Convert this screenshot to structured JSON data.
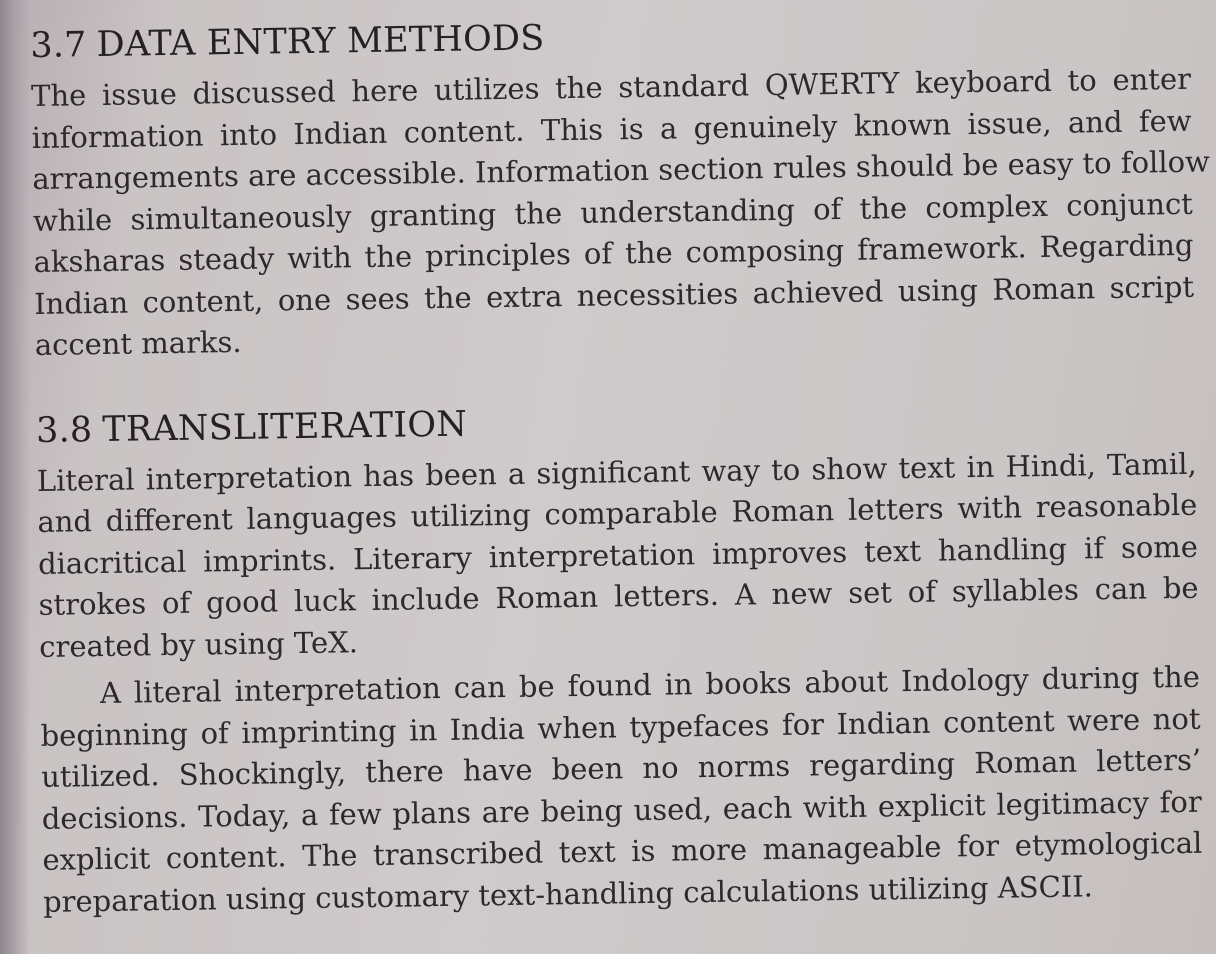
{
  "sections": [
    {
      "number": "3.7",
      "title": "DATA ENTRY METHODS",
      "paragraphs": [
        {
          "lines": [
            "The issue discussed here utilizes the standard QWERTY keyboard to enter",
            "information into Indian content. This is a genuinely known issue, and few",
            "arrangements are accessible. Information section rules should be easy to follow",
            "while simultaneously granting the understanding of the complex conjunct",
            "aksharas steady with the principles of the composing framework. Regarding",
            "Indian content, one sees the extra necessities achieved using Roman script",
            "accent marks."
          ]
        }
      ]
    },
    {
      "number": "3.8",
      "title": "TRANSLITERATION",
      "paragraphs": [
        {
          "lines": [
            "Literal interpretation has been a significant way to show text in Hindi, Tamil,",
            "and different languages utilizing comparable Roman letters with reasonable",
            "diacritical imprints. Literary interpretation improves text handling if some",
            "strokes of good luck include Roman letters. A new set of syllables can be",
            "created by using TeX."
          ]
        },
        {
          "lines": [
            "A literal interpretation can be found in books about Indology during the",
            "beginning of imprinting in India when typefaces for Indian content were not",
            "utilized. Shockingly, there have been no norms regarding Roman letters’",
            "decisions. Today, a few plans are being used, each with explicit legitimacy for",
            "explicit content. The transcribed text is more manageable for etymological",
            "preparation using customary text-handling calculations utilizing ASCII."
          ]
        }
      ]
    }
  ]
}
